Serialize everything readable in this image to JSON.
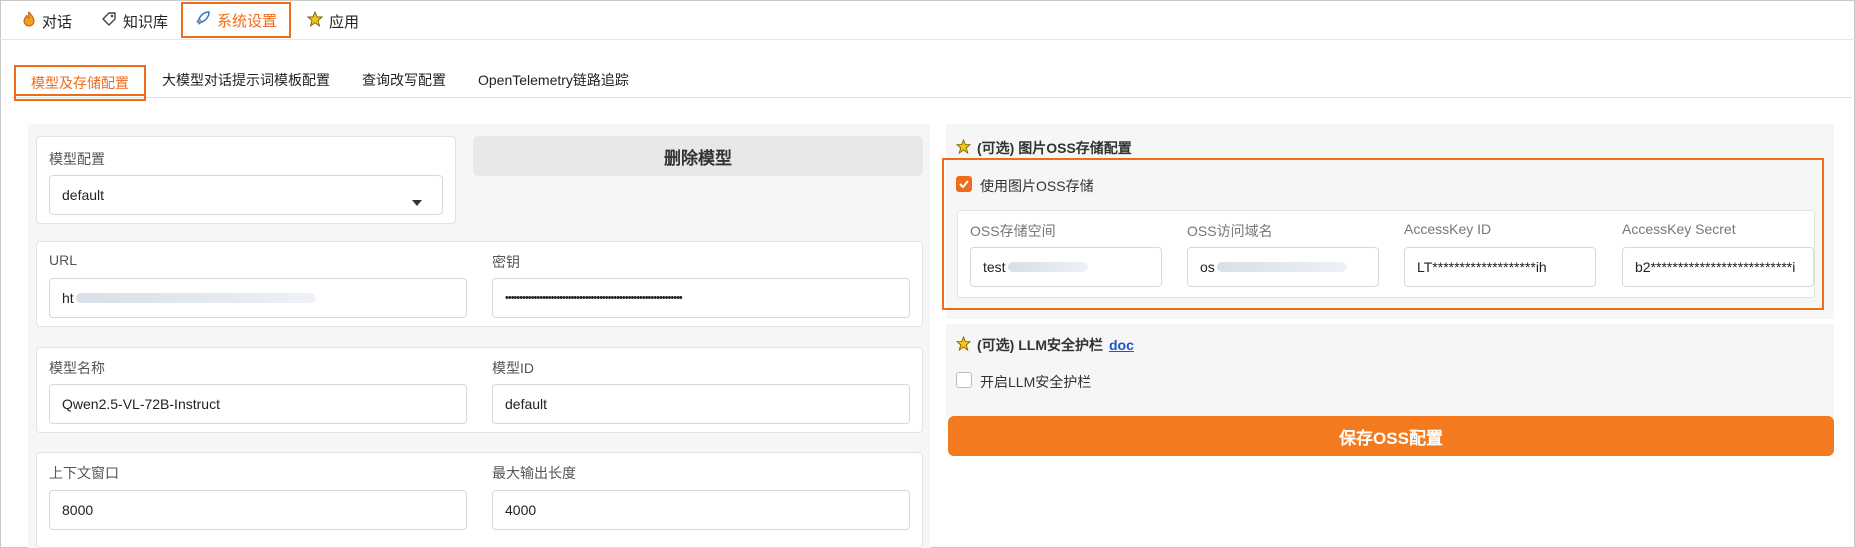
{
  "nav": {
    "tabs": [
      {
        "label": "对话",
        "icon": "flame-icon"
      },
      {
        "label": "知识库",
        "icon": "tag-icon"
      },
      {
        "label": "系统设置",
        "icon": "rocket-icon",
        "active": true
      },
      {
        "label": "应用",
        "icon": "star-icon"
      }
    ]
  },
  "subtabs": [
    {
      "label": "模型及存储配置",
      "active": true
    },
    {
      "label": "大模型对话提示词模板配置"
    },
    {
      "label": "查询改写配置"
    },
    {
      "label": "OpenTelemetry链路追踪"
    }
  ],
  "model": {
    "config_label": "模型配置",
    "config_value": "default",
    "delete_button": "删除模型",
    "url_label": "URL",
    "url_value": "ht",
    "key_label": "密钥",
    "key_value": "••••••••••••••••••••••••••••••••••••••••••••••••••••••••••••••",
    "name_label": "模型名称",
    "name_value": "Qwen2.5-VL-72B-Instruct",
    "id_label": "模型ID",
    "id_value": "default",
    "context_label": "上下文窗口",
    "context_value": "8000",
    "max_output_label": "最大输出长度",
    "max_output_value": "4000"
  },
  "oss": {
    "section_title": "(可选) 图片OSS存储配置",
    "use_oss_label": "使用图片OSS存储",
    "use_oss_checked": true,
    "bucket_label": "OSS存储空间",
    "bucket_value": "test",
    "domain_label": "OSS访问域名",
    "domain_value": "os",
    "ak_id_label": "AccessKey ID",
    "ak_id_value": "LT*******************ih",
    "ak_secret_label": "AccessKey Secret",
    "ak_secret_value": "b2**************************i"
  },
  "guardrail": {
    "section_title": "(可选) LLM安全护栏",
    "doc_link": "doc",
    "enable_label": "开启LLM安全护栏",
    "enabled": false
  },
  "save_button": "保存OSS配置",
  "colors": {
    "accent": "#ef6c1a",
    "button": "#f47a1f",
    "link": "#1a57c8"
  }
}
